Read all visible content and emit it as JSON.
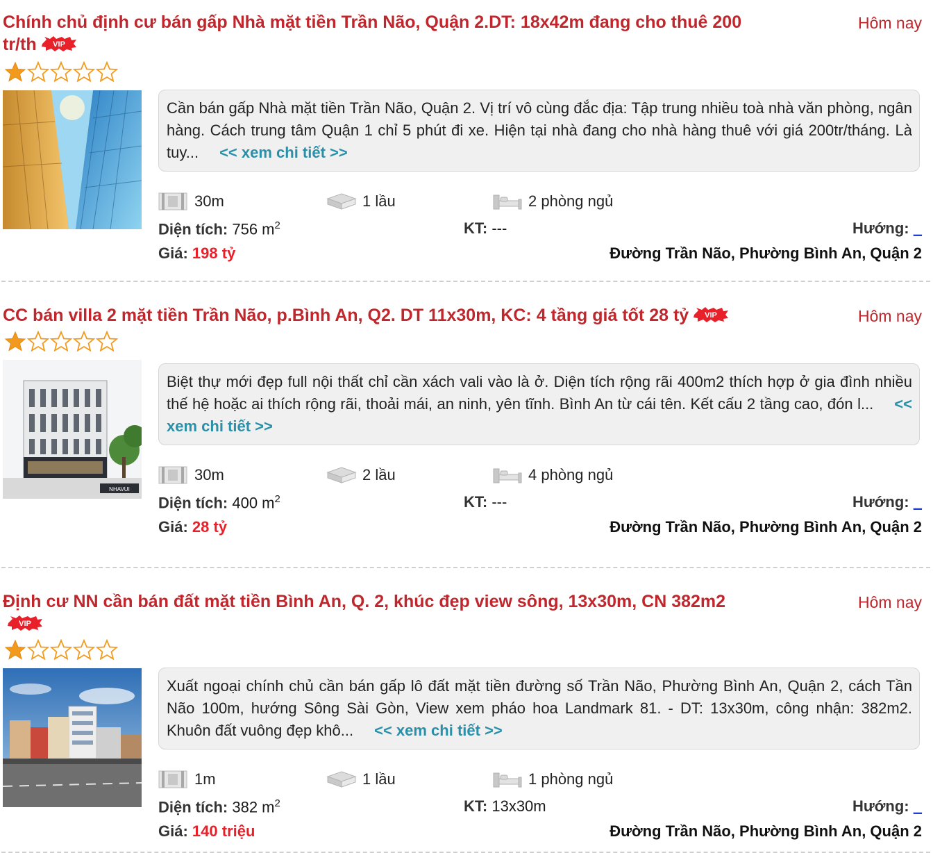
{
  "listings": [
    {
      "title": "Chính chủ định cư bán gấp Nhà mặt tiền Trần Não, Quận 2.DT: 18x42m đang cho thuê 200 tr/th",
      "date": "Hôm nay",
      "rating": 1,
      "description": "Cần bán gấp Nhà mặt tiền Trần Não, Quận 2. Vị trí vô cùng đắc địa: Tập trung nhiều toà nhà văn phòng, ngân hàng. Cách trung tâm Quận 1 chỉ 5 phút đi xe. Hiện tại nhà đang cho nhà hàng thuê với giá 200tr/tháng. Là tuy...",
      "more_link": "<< xem chi tiết >>",
      "frontage": "30m",
      "floors": "1 lầu",
      "bedrooms": "2 phòng ngủ",
      "area_label": "Diện tích:",
      "area_value": "756 m",
      "area_sup": "2",
      "kt_label": "KT:",
      "kt_value": "---",
      "direction_label": "Hướng:",
      "direction_value": "_",
      "price_label": "Giá:",
      "price_value": "198 tỷ",
      "address": "Đường Trần Não, Phường Bình An, Quận 2"
    },
    {
      "title": "CC bán villa 2 mặt tiền Trần Não, p.Bình An, Q2. DT 11x30m, KC: 4 tầng giá tốt 28 tỷ",
      "date": "Hôm nay",
      "rating": 1,
      "description": "Biệt thự mới đẹp full nội thất chỉ cần xách vali vào là ở. Diện tích rộng rãi 400m2 thích hợp ở gia đình nhiều thế hệ hoặc ai thích rộng rãi, thoải mái, an ninh, yên tĩnh. Bình An từ cái tên. Kết cấu 2 tầng cao, đón l...",
      "more_link": "<< xem chi tiết >>",
      "frontage": "30m",
      "floors": "2 lầu",
      "bedrooms": "4 phòng ngủ",
      "area_label": "Diện tích:",
      "area_value": "400 m",
      "area_sup": "2",
      "kt_label": "KT:",
      "kt_value": "---",
      "direction_label": "Hướng:",
      "direction_value": "_",
      "price_label": "Giá:",
      "price_value": "28 tỷ",
      "address": "Đường Trần Não, Phường Bình An, Quận 2"
    },
    {
      "title": "Định cư NN cần bán đất mặt tiền Bình An, Q. 2, khúc đẹp view sông, 13x30m, CN 382m2",
      "date": "Hôm nay",
      "rating": 1,
      "description": "Xuất ngoại chính chủ cần bán gấp lô đất mặt tiền đường số Trần Não, Phường Bình An, Quận 2, cách Tần Não 100m, hướng Sông Sài Gòn, View xem pháo hoa Landmark 81. - DT: 13x30m, công nhận: 382m2. Khuôn đất vuông đẹp khô...",
      "more_link": "<< xem chi tiết >>",
      "frontage": "1m",
      "floors": "1 lầu",
      "bedrooms": "1 phòng ngủ",
      "area_label": "Diện tích:",
      "area_value": "382 m",
      "area_sup": "2",
      "kt_label": "KT:",
      "kt_value": "13x30m",
      "direction_label": "Hướng:",
      "direction_value": "_",
      "price_label": "Giá:",
      "price_value": "140 triệu",
      "address": "Đường Trần Não, Phường Bình An, Quận 2"
    }
  ],
  "icons": {
    "vip_badge": "vip-badge-icon",
    "frontage": "frontage-icon",
    "floors": "floors-icon",
    "bedrooms": "bed-icon",
    "star": "star-icon"
  },
  "colors": {
    "title": "#c0272d",
    "price": "#e8202a",
    "link": "#2a8fa8",
    "star": "#f29a1d",
    "direction": "#1b3fd1"
  }
}
